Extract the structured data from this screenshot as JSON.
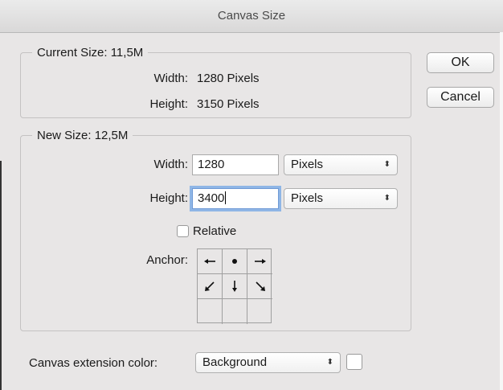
{
  "window": {
    "title": "Canvas Size"
  },
  "current_size": {
    "legend": "Current Size: 11,5M",
    "width_label": "Width:",
    "width_value": "1280 Pixels",
    "height_label": "Height:",
    "height_value": "3150 Pixels"
  },
  "new_size": {
    "legend": "New Size: 12,5M",
    "width_label": "Width:",
    "width_value": "1280",
    "width_unit": "Pixels",
    "height_label": "Height:",
    "height_value": "3400",
    "height_unit": "Pixels",
    "relative_label": "Relative",
    "relative_checked": false,
    "anchor_label": "Anchor:",
    "anchor_cells": [
      "arrow-left-icon",
      "anchor-dot-icon",
      "arrow-right-icon",
      "arrow-down-left-icon",
      "arrow-down-icon",
      "arrow-down-right-icon",
      "",
      "",
      ""
    ]
  },
  "buttons": {
    "ok": "OK",
    "cancel": "Cancel"
  },
  "extension": {
    "label": "Canvas extension color:",
    "value": "Background",
    "swatch_color": "#ffffff"
  },
  "icons": {
    "select_arrows": "⇕"
  }
}
